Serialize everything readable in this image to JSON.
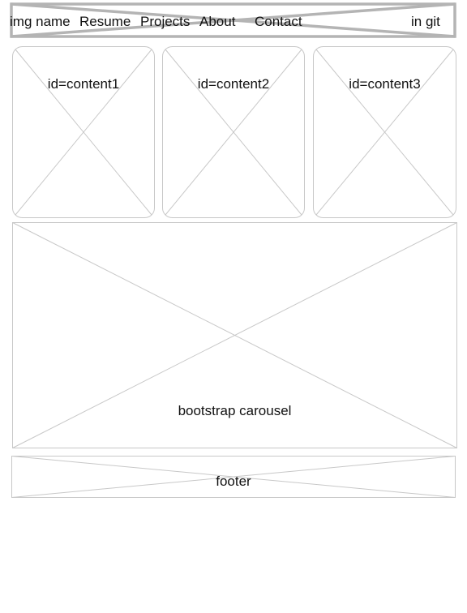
{
  "navbar": {
    "img_name": "img name",
    "resume": "Resume",
    "projects": "Projects",
    "about": "About",
    "contact": "Contact",
    "social": "in git"
  },
  "content": [
    {
      "label": "id=content1"
    },
    {
      "label": "id=content2"
    },
    {
      "label": "id=content3"
    }
  ],
  "carousel": {
    "label": "bootstrap carousel"
  },
  "footer": {
    "label": "footer"
  },
  "colors": {
    "wire_light": "#c8c8c8",
    "wire_dark": "#b4b4b4",
    "text": "#111111",
    "background": "#ffffff"
  }
}
